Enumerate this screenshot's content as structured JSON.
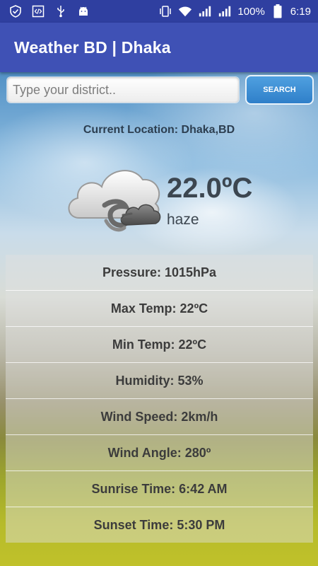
{
  "status_bar": {
    "battery_percent": "100%",
    "time": "6:19",
    "icons": [
      "shield-icon",
      "code-icon",
      "usb-icon",
      "android-icon",
      "vibrate-icon",
      "wifi-icon",
      "signal-icon",
      "signal-icon",
      "battery-icon"
    ]
  },
  "app_bar": {
    "title": "Weather BD | Dhaka"
  },
  "search": {
    "placeholder": "Type your district..",
    "value": "",
    "button_label": "SEARCH"
  },
  "current": {
    "location": "Current Location: Dhaka,BD",
    "temperature": "22.0ºC",
    "condition": "haze",
    "icon": "cloud-haze-icon"
  },
  "details": [
    {
      "text": "Pressure: 1015hPa"
    },
    {
      "text": "Max Temp: 22ºC"
    },
    {
      "text": "Min Temp: 22ºC"
    },
    {
      "text": "Humidity: 53%"
    },
    {
      "text": "Wind Speed: 2km/h"
    },
    {
      "text": "Wind Angle: 280º"
    },
    {
      "text": "Sunrise Time: 6:42 AM"
    },
    {
      "text": "Sunset Time: 5:30 PM"
    }
  ],
  "colors": {
    "status_bar": "#2f3fa0",
    "app_bar": "#3f51b5",
    "button": "#3a8ad4"
  }
}
